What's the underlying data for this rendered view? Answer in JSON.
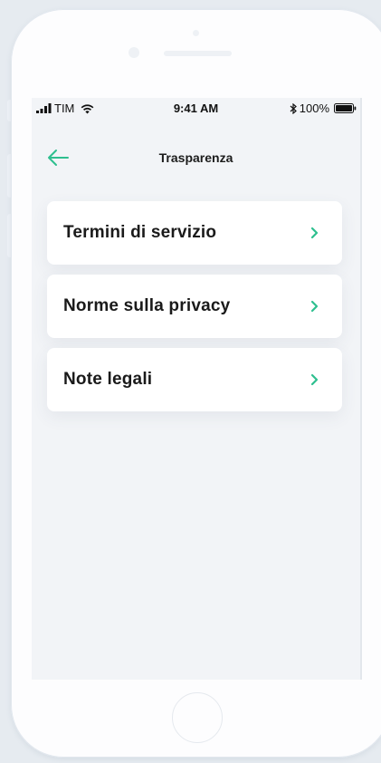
{
  "status_bar": {
    "carrier": "TIM",
    "time": "9:41 AM",
    "battery": "100%"
  },
  "header": {
    "title": "Trasparenza",
    "back_icon": "arrow-left-icon"
  },
  "menu": {
    "items": [
      {
        "label": "Termini di servizio",
        "icon": "chevron-right-icon"
      },
      {
        "label": "Norme sulla privacy",
        "icon": "chevron-right-icon"
      },
      {
        "label": "Note legali",
        "icon": "chevron-right-icon"
      }
    ]
  },
  "colors": {
    "accent": "#2ebf8f",
    "screen_background": "#f2f4f7",
    "card_background": "#ffffff",
    "text": "#1a1a1a"
  }
}
